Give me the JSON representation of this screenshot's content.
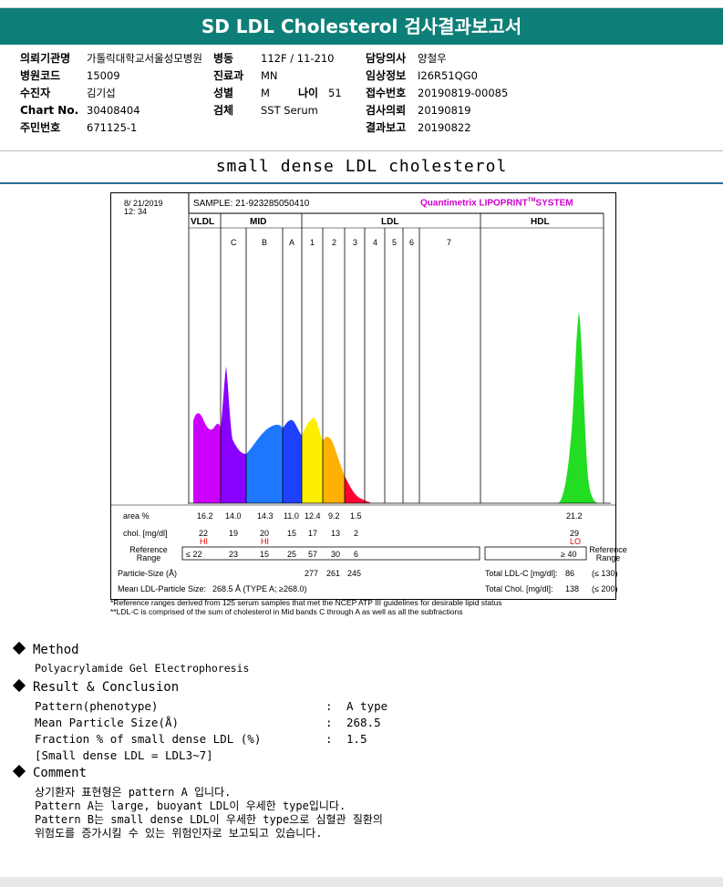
{
  "header": {
    "title": "SD LDL Cholesterol 검사결과보고서"
  },
  "patient": {
    "hospital_label": "의뢰기관명",
    "hospital": "가톨릭대학교서울성모병원",
    "ward_label": "병동",
    "ward": "112F / 11-210",
    "doctor_label": "담당의사",
    "doctor": "양철우",
    "code_label": "병원코드",
    "code": "15009",
    "dept_label": "진료과",
    "dept": "MN",
    "clinical_label": "임상정보",
    "clinical": "I26R51QG0",
    "name_label": "수진자",
    "name": "김기섭",
    "sex_label": "성별",
    "sex": "M",
    "age_label": "나이",
    "age": "51",
    "receipt_label": "접수번호",
    "receipt": "20190819-00085",
    "chart_label": "Chart No.",
    "chart": "30408404",
    "specimen_label": "검체",
    "specimen": "SST Serum",
    "req_label": "검사의뢰",
    "req": "20190819",
    "id_label": "주민번호",
    "id": "671125-1",
    "report_label": "결과보고",
    "report": "20190822"
  },
  "subtitle": "small dense LDL cholesterol",
  "lipoprint": {
    "date": "8/ 21/2019",
    "time": "12: 34",
    "sample": "SAMPLE:  21-923285050410",
    "system": "Quantimetrix LIPOPRINT",
    "system_tm": "TM",
    "system_suffix": "SYSTEM",
    "groups": [
      "VLDL",
      "MID",
      "LDL",
      "HDL"
    ],
    "bands": [
      "C",
      "B",
      "A",
      "1",
      "2",
      "3",
      "4",
      "5",
      "6",
      "7"
    ],
    "area_label": "area %",
    "area": [
      "16.2",
      "14.0",
      "14.3",
      "11.0",
      "12.4",
      "9.2",
      "1.5",
      "21.2"
    ],
    "chol_label": "chol. [mg/dl]",
    "chol": [
      "22",
      "19",
      "20",
      "15",
      "17",
      "13",
      "2",
      "29"
    ],
    "flags": [
      "HI",
      "HI",
      "LO"
    ],
    "ref_label": "Reference Range",
    "ref": [
      "≤ 22",
      "23",
      "15",
      "25",
      "57",
      "30",
      "6",
      "≥ 40"
    ],
    "particle_label": "Particle-Size (Å)",
    "particle": [
      "277",
      "261",
      "245"
    ],
    "mean_label": "Mean LDL-Particle Size:",
    "mean_value": "268.5 Å  (TYPE A; ≥268.0)",
    "total_ldl_label": "Total LDL-C [mg/dl]:",
    "total_ldl": "86",
    "total_ldl_ref": "(≤ 130)",
    "total_chol_label": "Total Chol. [mg/dl]:",
    "total_chol": "138",
    "total_chol_ref": "(≤ 200)",
    "foot1": "*Reference ranges derived from 125 serum samples that met the NCEP ATP III guidelines for desirable lipid status",
    "foot2": "**LDL-C is comprised of the sum of cholesterol in Mid bands C through A as well as all the subfractions"
  },
  "method": {
    "title": "Method",
    "text": "Polyacrylamide Gel Electrophoresis"
  },
  "result": {
    "title": "Result & Conclusion",
    "rows": [
      {
        "label": "Pattern(phenotype)",
        "value": "A type"
      },
      {
        "label": "Mean Particle Size(Å)",
        "value": "268.5"
      },
      {
        "label": "Fraction % of small dense LDL (%)",
        "value": "1.5"
      }
    ],
    "note": "[Small dense LDL = LDL3~7]",
    "sep": ":"
  },
  "comment": {
    "title": "Comment",
    "lines": [
      "상기환자 표현형은 pattern A 입니다.",
      "Pattern A는 large, buoyant LDL이 우세한 type입니다.",
      "Pattern B는 small dense LDL이 우세한 type으로 심혈관 질환의",
      "위험도를 증가시킬 수 있는 위험인자로 보고되고 있습니다."
    ]
  },
  "colors": {
    "header_bg": "#0e7f78",
    "vldl": "#cc00ff",
    "c": "#8a00ff",
    "b": "#1e78ff",
    "a": "#1e3cff",
    "l1": "#ffee00",
    "l2": "#ffb000",
    "l3": "#ff0033",
    "hdl": "#22dd22",
    "flag": "#e00000"
  }
}
